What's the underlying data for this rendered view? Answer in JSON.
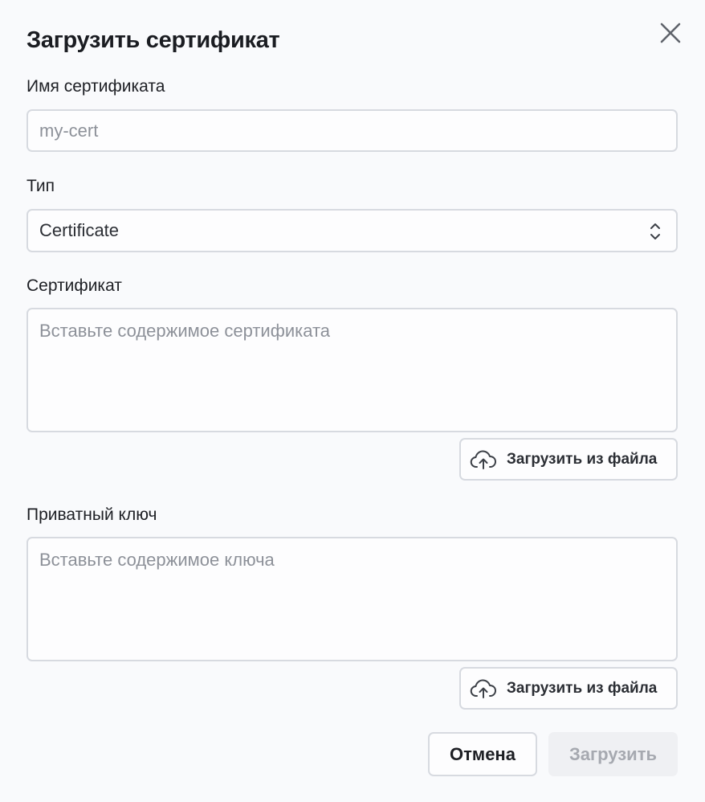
{
  "dialog": {
    "title": "Загрузить сертификат",
    "close_icon": "close-icon"
  },
  "fields": {
    "name": {
      "label": "Имя сертификата",
      "value": "",
      "placeholder": "my-cert"
    },
    "type": {
      "label": "Тип",
      "selected": "Certificate",
      "icon": "chevron-up-down-icon"
    },
    "certificate": {
      "label": "Сертификат",
      "value": "",
      "placeholder": "Вставьте содержимое сертификата",
      "upload_label": "Загрузить из файла",
      "upload_icon": "cloud-upload-icon"
    },
    "private_key": {
      "label": "Приватный ключ",
      "value": "",
      "placeholder": "Вставьте содержимое ключа",
      "upload_label": "Загрузить из файла",
      "upload_icon": "cloud-upload-icon"
    }
  },
  "actions": {
    "cancel_label": "Отмена",
    "submit_label": "Загрузить",
    "submit_disabled": true
  },
  "colors": {
    "background": "#f9fafc",
    "border": "#d7dae0",
    "text": "#1d1f24",
    "placeholder": "#8d9199",
    "disabled_bg": "#eff0f3",
    "disabled_text": "#a6a9b0"
  }
}
